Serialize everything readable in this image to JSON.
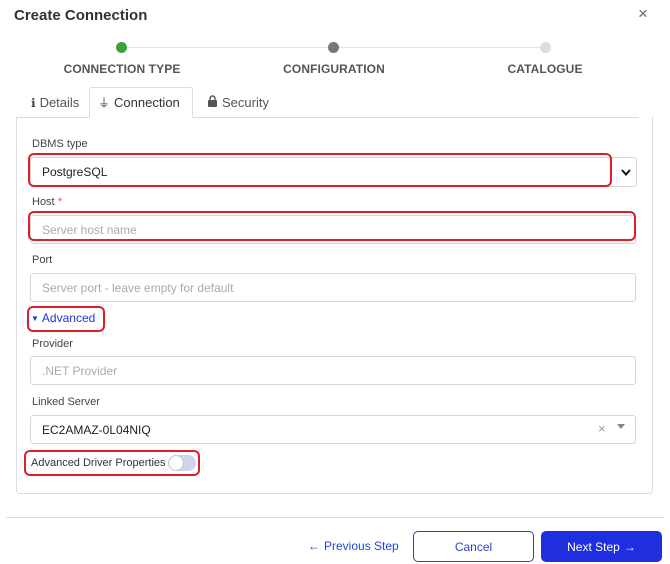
{
  "dialog": {
    "title": "Create Connection",
    "close_glyph": "×"
  },
  "stepper": {
    "steps": [
      {
        "label": "CONNECTION TYPE",
        "state": "done",
        "color": "#3aa335"
      },
      {
        "label": "CONFIGURATION",
        "state": "current",
        "color": "#777777"
      },
      {
        "label": "CATALOGUE",
        "state": "pending",
        "color": "#dddddd"
      }
    ]
  },
  "tabs": [
    {
      "label": "Details",
      "icon": "info-icon",
      "glyph": "ℹ",
      "active": false
    },
    {
      "label": "Connection",
      "icon": "plug-icon",
      "glyph": "⏚",
      "active": true
    },
    {
      "label": "Security",
      "icon": "lock-icon",
      "glyph": "🔒",
      "active": false
    }
  ],
  "form": {
    "dbms_type": {
      "label": "DBMS type",
      "value": "PostgreSQL",
      "arrow": "▾"
    },
    "host": {
      "label": "Host",
      "required_mark": "*",
      "placeholder": "Server host name"
    },
    "port": {
      "label": "Port",
      "placeholder": "Server port - leave empty for default"
    },
    "advanced": {
      "label": "Advanced",
      "caret": "▼"
    },
    "provider": {
      "label": "Provider",
      "placeholder": ".NET Provider"
    },
    "linked_server": {
      "label": "Linked Server",
      "value": "EC2AMAZ-0L04NIQ",
      "clear_glyph": "×"
    },
    "advanced_driver_properties": {
      "label": "Advanced Driver Properties",
      "enabled": false
    }
  },
  "footer": {
    "previous_label": "Previous Step",
    "previous_arrow": "←",
    "cancel_label": "Cancel",
    "next_label": "Next Step",
    "next_arrow": "→"
  },
  "colors": {
    "accent": "#1f2fe0",
    "highlight": "#dd1f2c",
    "step_done": "#3aa335"
  }
}
